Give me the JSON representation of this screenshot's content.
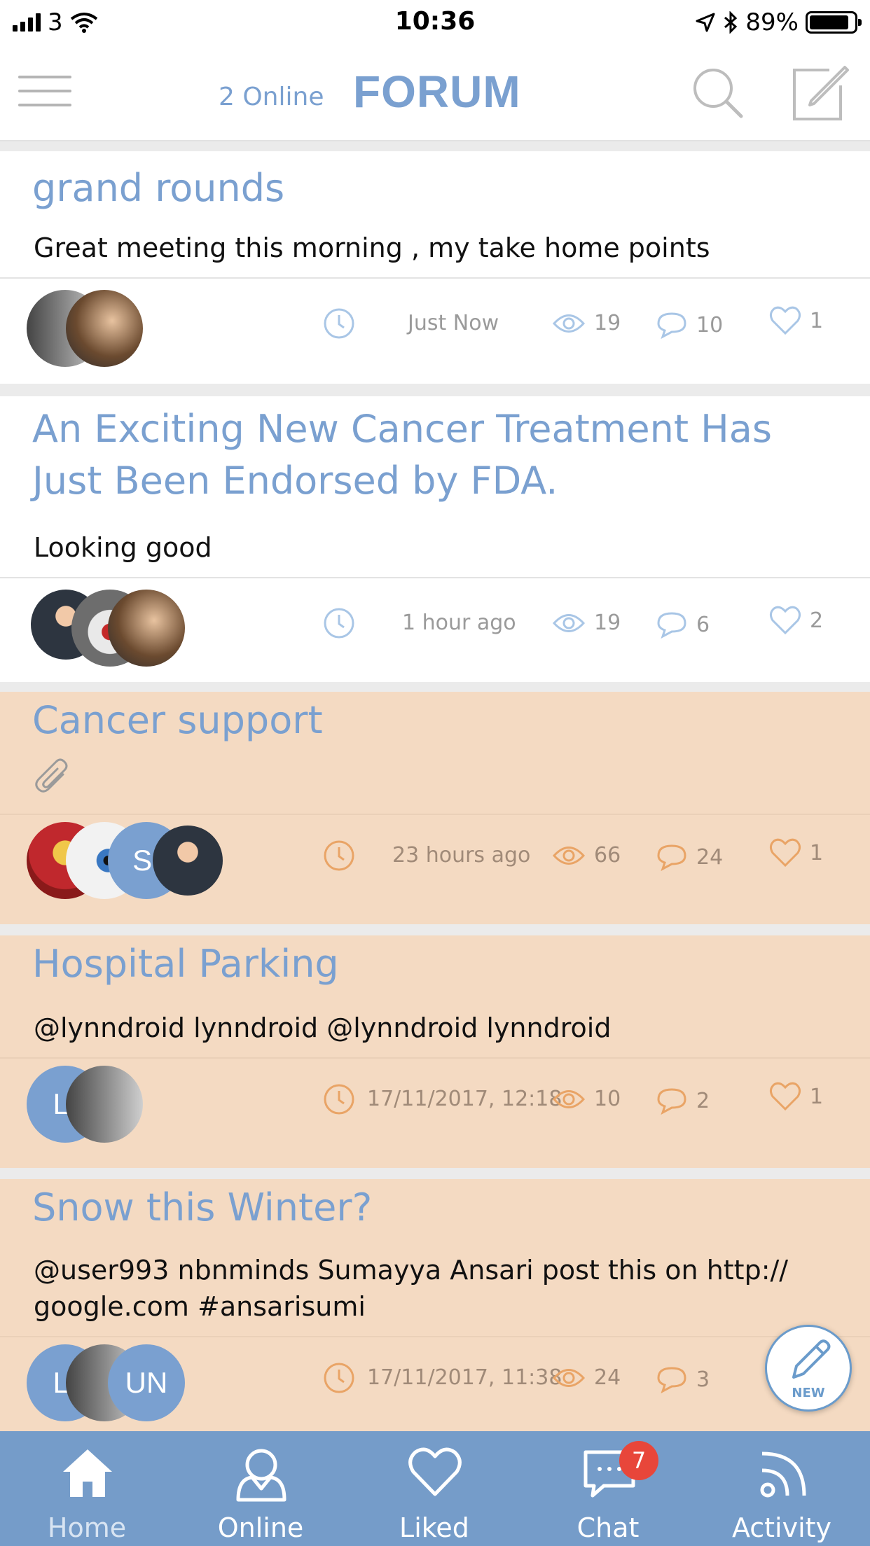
{
  "status_bar": {
    "carrier": "3",
    "time": "10:36",
    "battery": "89%"
  },
  "nav": {
    "online": "2 Online",
    "title": "FORUM"
  },
  "posts": [
    {
      "title": "grand rounds",
      "body": "Great meeting this morning , my take home points",
      "time": "Just Now",
      "views": "19",
      "comments": "10",
      "likes": "1"
    },
    {
      "title": "An Exciting New Cancer Treatment Has Just Been Endorsed by FDA.",
      "body": "Looking good",
      "time": "1 hour ago",
      "views": "19",
      "comments": "6",
      "likes": "2"
    },
    {
      "title": "Cancer support",
      "body": "",
      "time": "23 hours ago",
      "views": "66",
      "comments": "24",
      "likes": "1",
      "avatar_initials": "SI"
    },
    {
      "title": "Hospital Parking",
      "body": "@lynndroid lynndroid  @lynndroid lynndroid",
      "time": "17/11/2017, 12:18",
      "views": "10",
      "comments": "2",
      "likes": "1",
      "avatar_initials": "LI"
    },
    {
      "title": "Snow this Winter?",
      "body": "@user993 nbnminds  Sumayya Ansari post this on  http:// google.com    #ansarisumi",
      "time": "17/11/2017, 11:38",
      "views": "24",
      "comments": "3",
      "avatar_initials_1": "LI",
      "avatar_initials_2": "UN"
    }
  ],
  "fab": {
    "label": "NEW"
  },
  "tabs": [
    {
      "label": "Home",
      "active": true
    },
    {
      "label": "Online"
    },
    {
      "label": "Liked"
    },
    {
      "label": "Chat",
      "badge": "7"
    },
    {
      "label": "Activity"
    }
  ],
  "colors": {
    "accent": "#7aa0d0",
    "tab_bar": "#759cc9",
    "peach": "#f4dac2",
    "badge": "#e8463a",
    "icon_blue": "#a9c6e6",
    "icon_orange": "#e9a466"
  }
}
